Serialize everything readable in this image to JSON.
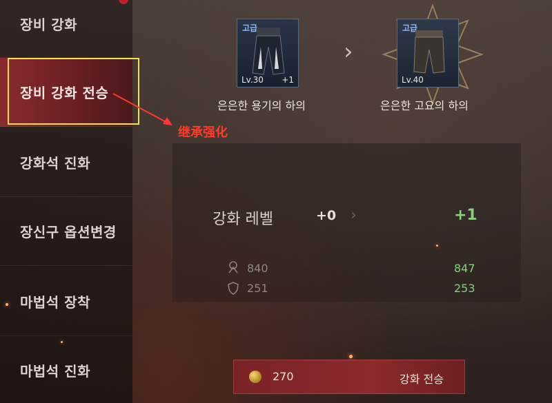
{
  "sidebar": {
    "items": [
      {
        "label": "장비 강화"
      },
      {
        "label": "장비 강화 전승"
      },
      {
        "label": "강화석 진화"
      },
      {
        "label": "장신구 옵션변경"
      },
      {
        "label": "마법석 장착"
      },
      {
        "label": "마법석 진화"
      }
    ]
  },
  "annotation": {
    "text": "继承强化"
  },
  "source_item": {
    "grade": "고급",
    "level": "Lv.30",
    "plus": "+1",
    "name": "은은한 용기의 하의"
  },
  "target_item": {
    "grade": "고급",
    "level": "Lv.40",
    "name": "은은한 고요의 하의"
  },
  "stats": {
    "level_label": "강화 레벨",
    "from": "+0",
    "to": "+1",
    "rows": [
      {
        "icon": "attack-icon",
        "old": "840",
        "new": "847"
      },
      {
        "icon": "defense-icon",
        "old": "251",
        "new": "253"
      }
    ]
  },
  "action": {
    "cost": "270",
    "label": "강화 전승",
    "icon": "gold-coin-icon"
  },
  "colors": {
    "accent": "#8a2a2f",
    "positive": "#83d37a",
    "highlight": "#f6e24a",
    "annotation": "#ff3a2a"
  }
}
